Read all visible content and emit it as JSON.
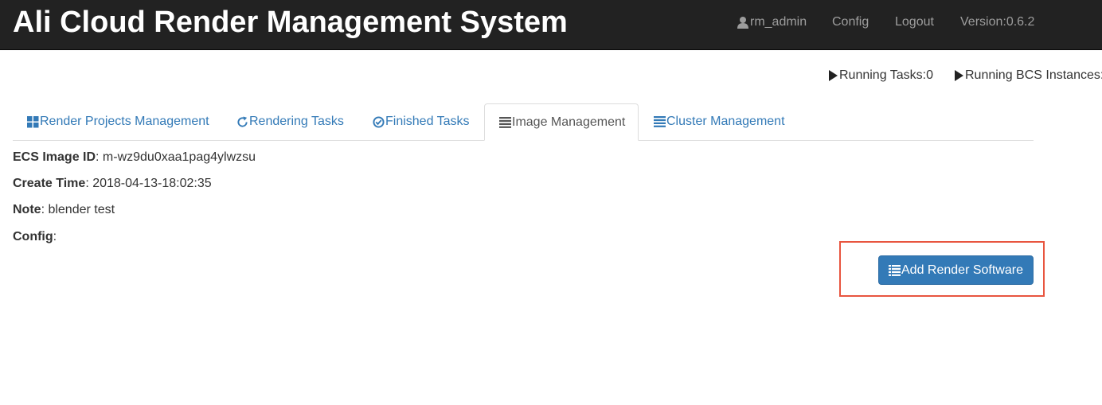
{
  "app": {
    "title": "Ali Cloud Render Management System"
  },
  "nav": {
    "user": "rm_admin",
    "config": "Config",
    "logout": "Logout",
    "version": "Version:0.6.2"
  },
  "status": {
    "running_tasks": "Running Tasks:0",
    "running_bcs_instances": "Running BCS Instances:"
  },
  "tabs": [
    {
      "label": "Render Projects Management",
      "icon": "th-large-icon",
      "active": false
    },
    {
      "label": "Rendering Tasks",
      "icon": "refresh-icon",
      "active": false
    },
    {
      "label": "Finished Tasks",
      "icon": "check-circle-icon",
      "active": false
    },
    {
      "label": "Image Management",
      "icon": "list-icon",
      "active": true
    },
    {
      "label": "Cluster Management",
      "icon": "list-icon",
      "active": false
    }
  ],
  "image": {
    "ecs_image_id_label": "ECS Image ID",
    "ecs_image_id": "m-wz9du0xaa1pag4ylwzsu",
    "create_time_label": "Create Time",
    "create_time": "2018-04-13-18:02:35",
    "note_label": "Note",
    "note": "blender test",
    "config_label": "Config",
    "config": ""
  },
  "actions": {
    "add_render_software": "Add Render Software"
  },
  "colors": {
    "navbar": "#222222",
    "link": "#337ab7",
    "primary": "#337ab7",
    "highlight": "#e8553f"
  }
}
